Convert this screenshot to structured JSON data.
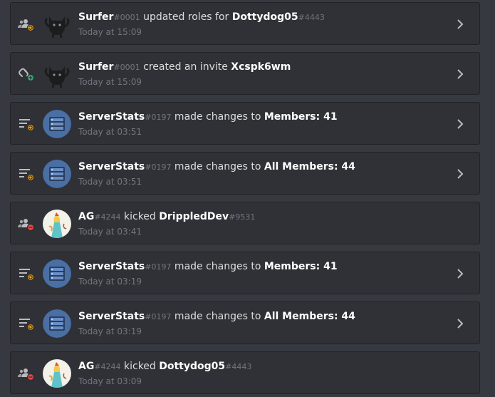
{
  "entries": [
    {
      "kind": "member-role",
      "avatar": "cat",
      "user": "Surfer",
      "user_disc": "#0001",
      "action": " updated roles for ",
      "target": "Dottydog05",
      "target_disc": "#4443",
      "time": "Today at 15:09",
      "expandable": true
    },
    {
      "kind": "invite-create",
      "avatar": "cat",
      "user": "Surfer",
      "user_disc": "#0001",
      "action": " created an invite ",
      "target": "Xcspk6wm",
      "target_disc": "",
      "time": "Today at 15:09",
      "expandable": true
    },
    {
      "kind": "channel-update",
      "avatar": "bot",
      "user": "ServerStats",
      "user_disc": "#0197",
      "action": " made changes to ",
      "target": "Members: 41",
      "target_disc": "",
      "time": "Today at 03:51",
      "expandable": true
    },
    {
      "kind": "channel-update",
      "avatar": "bot",
      "user": "ServerStats",
      "user_disc": "#0197",
      "action": " made changes to ",
      "target": "All Members: 44",
      "target_disc": "",
      "time": "Today at 03:51",
      "expandable": true
    },
    {
      "kind": "member-kick",
      "avatar": "ag",
      "user": "AG",
      "user_disc": "#4244",
      "action": " kicked ",
      "target": "DrippledDev",
      "target_disc": "#9531",
      "time": "Today at 03:41",
      "expandable": false
    },
    {
      "kind": "channel-update",
      "avatar": "bot",
      "user": "ServerStats",
      "user_disc": "#0197",
      "action": " made changes to ",
      "target": "Members: 41",
      "target_disc": "",
      "time": "Today at 03:19",
      "expandable": true
    },
    {
      "kind": "channel-update",
      "avatar": "bot",
      "user": "ServerStats",
      "user_disc": "#0197",
      "action": " made changes to ",
      "target": "All Members: 44",
      "target_disc": "",
      "time": "Today at 03:19",
      "expandable": true
    },
    {
      "kind": "member-kick",
      "avatar": "ag",
      "user": "AG",
      "user_disc": "#4244",
      "action": " kicked ",
      "target": "Dottydog05",
      "target_disc": "#4443",
      "time": "Today at 03:09",
      "expandable": false
    }
  ],
  "colors": {
    "background": "#36393f",
    "entry": "#2f3136",
    "update_badge": "#faa61a",
    "create_badge": "#43b581",
    "delete_badge": "#f04747",
    "icon": "#b9bbbe"
  }
}
